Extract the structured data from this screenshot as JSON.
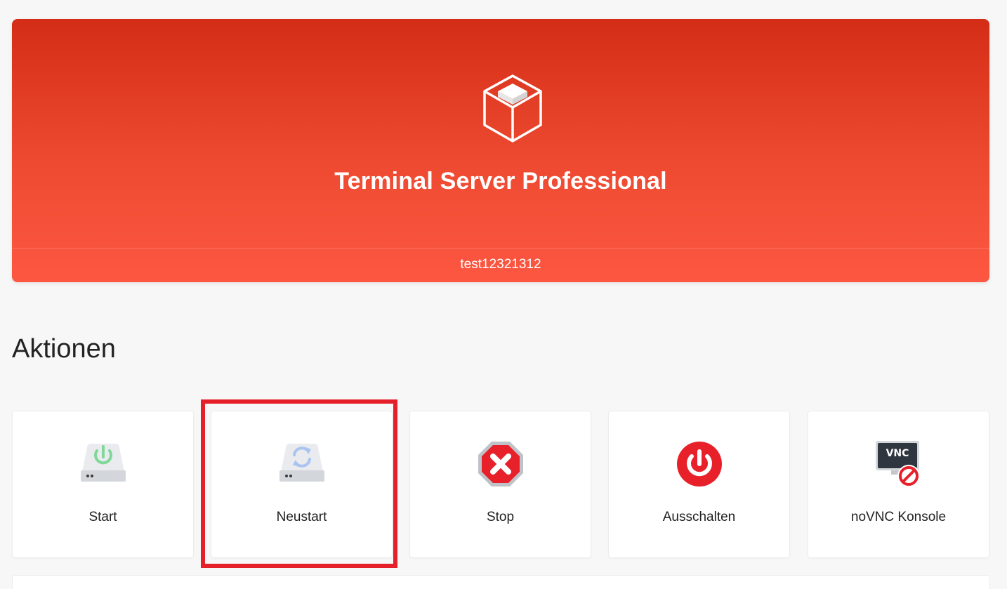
{
  "hero": {
    "title": "Terminal Server Professional",
    "subtitle": "test12321312",
    "icon": "package-box-icon"
  },
  "actions": {
    "heading": "Aktionen",
    "items": [
      {
        "label": "Start",
        "icon": "drive-power-icon"
      },
      {
        "label": "Neustart",
        "icon": "drive-restart-icon"
      },
      {
        "label": "Stop",
        "icon": "stop-sign-icon"
      },
      {
        "label": "Ausschalten",
        "icon": "power-off-icon"
      },
      {
        "label": "noVNC Konsole",
        "icon": "vnc-disabled-icon"
      }
    ]
  },
  "colors": {
    "hero_top": "#d42d17",
    "hero_bottom": "#fd5742",
    "highlight": "#e5202a",
    "start_green": "#7fd89a",
    "restart_blue": "#a9c4f0",
    "stop_red": "#e8202a",
    "vnc_dark": "#2f3640"
  }
}
